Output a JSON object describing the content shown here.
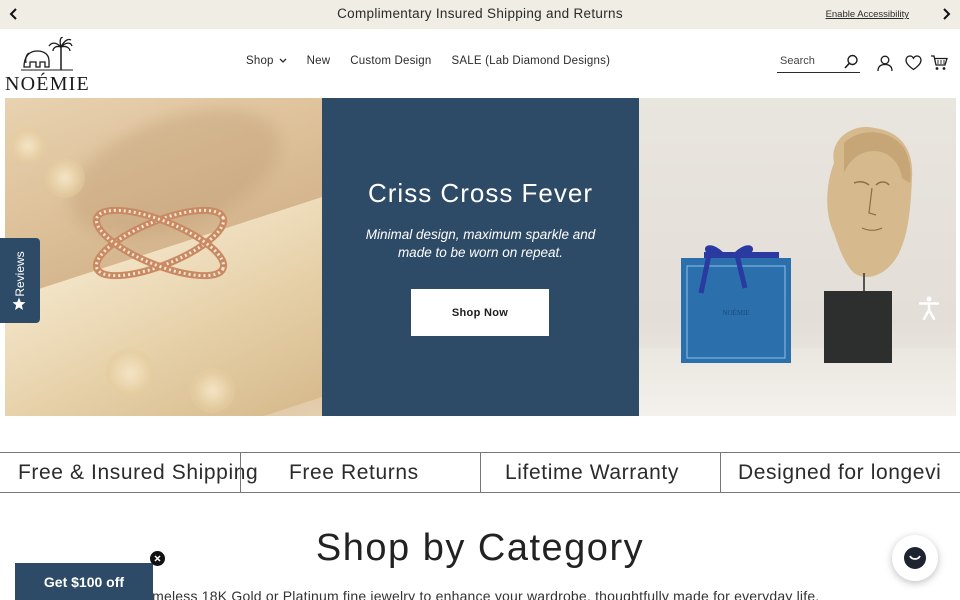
{
  "announcement": {
    "message": "Complimentary Insured Shipping and Returns",
    "accessibility_link": "Enable Accessibility"
  },
  "header": {
    "logo_text": "NOÉMIE",
    "nav": [
      {
        "label": "Shop",
        "has_dropdown": true
      },
      {
        "label": "New"
      },
      {
        "label": "Custom Design"
      },
      {
        "label": "SALE (Lab Diamond Designs)"
      }
    ],
    "search_placeholder": "Search",
    "icons": [
      "search-icon",
      "account-icon",
      "wishlist-heart-icon",
      "cart-icon"
    ]
  },
  "hero": {
    "title": "Criss Cross Fever",
    "subtitle": "Minimal design, maximum sparkle and made to be worn on repeat.",
    "cta": "Shop Now",
    "box_brand": "NOÉMIE"
  },
  "reviews_tab": {
    "label": "Reviews"
  },
  "features": [
    "Free & Insured Shipping",
    "Free Returns",
    "Lifetime Warranty",
    "Designed for longevi"
  ],
  "category": {
    "title": "Shop by Category",
    "subtitle": "Timeless 18K Gold or Platinum fine jewelry to enhance your wardrobe, thoughtfully made for everyday life."
  },
  "promo": {
    "label": "Get $100 off"
  },
  "colors": {
    "navy": "#2d4a66",
    "announcement_bg": "#efede4",
    "text": "#222222"
  }
}
